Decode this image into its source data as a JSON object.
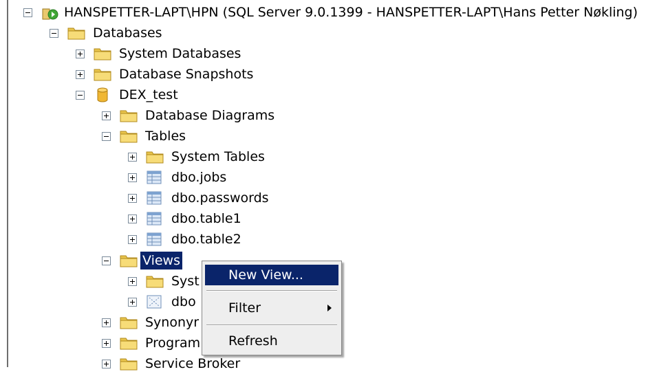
{
  "tree": {
    "server": "HANSPETTER-LAPT\\HPN (SQL Server 9.0.1399 - HANSPETTER-LAPT\\Hans Petter Nøkling)",
    "databases": "Databases",
    "system_databases": "System Databases",
    "database_snapshots": "Database Snapshots",
    "dex_test": "DEX_test",
    "database_diagrams": "Database Diagrams",
    "tables": "Tables",
    "system_tables": "System Tables",
    "dbo_jobs": "dbo.jobs",
    "dbo_passwords": "dbo.passwords",
    "dbo_table1": "dbo.table1",
    "dbo_table2": "dbo.table2",
    "views": "Views",
    "system_views_partial": "Syst",
    "dbo_view_partial": "dbo",
    "synonyms_partial": "Synonyr",
    "programmability_partial": "Program",
    "service_broker_partial": "Service Broker"
  },
  "context_menu": {
    "new_view": "New View...",
    "filter": "Filter",
    "refresh": "Refresh"
  },
  "icons": {
    "server": "server-running-icon",
    "folder": "folder-icon",
    "database": "database-cylinder-icon",
    "table": "table-icon",
    "view": "view-icon"
  },
  "colors": {
    "selection": "#0a246a",
    "folder": "#f5d86a",
    "menu_bg": "#eeeeee"
  }
}
